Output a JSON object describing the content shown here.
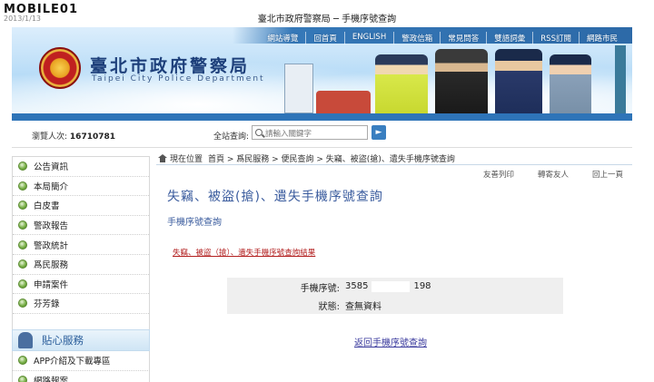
{
  "watermark": {
    "text": "MOBILE01",
    "date": "2013/1/13"
  },
  "window_title": "臺北市政府警察局 ─ 手機序號查詢",
  "header": {
    "title": "臺北市政府警察局",
    "subtitle": "Taipei City Police Department",
    "nav": [
      "網站導覽",
      "回首頁",
      "ENGLISH",
      "警政信箱",
      "常見問答",
      "雙語詞彙",
      "RSS訂閱",
      "網路市民"
    ]
  },
  "infobar": {
    "visitors_label": "瀏覽人次:",
    "visitors_count": "16710781",
    "search_label": "全站查詢:",
    "search_placeholder": "請輸入關鍵字"
  },
  "sidebar": {
    "items": [
      "公告資訊",
      "本局簡介",
      "白皮書",
      "警政報告",
      "警政統計",
      "爲民服務",
      "申請案件",
      "芬芳錄"
    ],
    "help_title": "貼心服務",
    "help_items": [
      "APP介紹及下載專區",
      "網路報案"
    ]
  },
  "breadcrumb": {
    "label": "現在位置",
    "path": "首頁 > 爲民服務 > 便民查詢 > 失竊、被盜(搶)、遺失手機序號查詢"
  },
  "tools": [
    "友善列印",
    "轉寄友人",
    "回上一頁"
  ],
  "content": {
    "title": "失竊、被盜(搶)、遺失手機序號查詢",
    "subtitle": "手機序號查詢",
    "result_link": "失竊、被盜（搶）、遺失手機序號查詢結果",
    "phone_label": "手機序號:",
    "phone_prefix": "3585",
    "phone_suffix": "198",
    "status_label": "狀態:",
    "status_value": "查無資料",
    "back_link": "返回手機序號查詢"
  }
}
